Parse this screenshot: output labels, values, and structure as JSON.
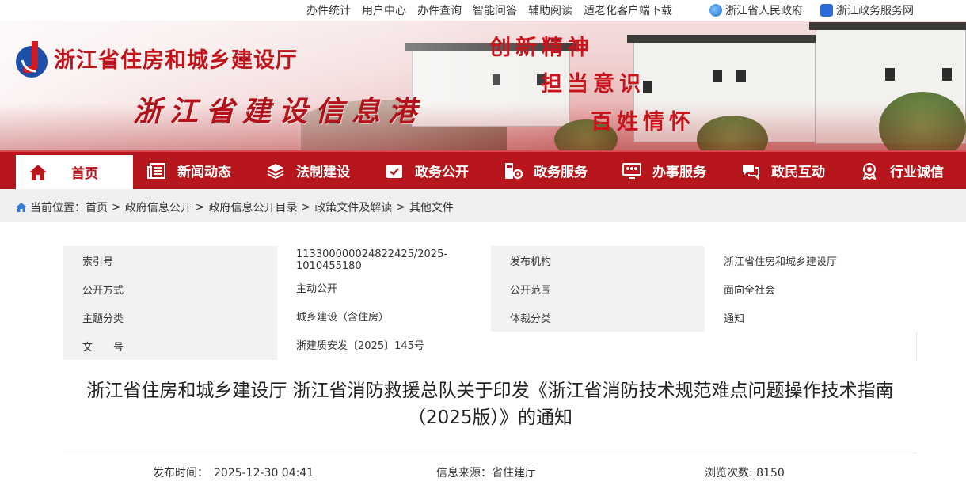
{
  "topbar": {
    "links": [
      "办件统计",
      "用户中心",
      "办件查询",
      "智能问答",
      "辅助阅读",
      "适老化客户端下载"
    ],
    "gov_links": [
      "浙江省人民政府",
      "浙江政务服务网"
    ]
  },
  "banner": {
    "org_name": "浙江省住房和城乡建设厅",
    "site_title": "浙江省建设信息港",
    "slogans": [
      "创新精神",
      "担当意识",
      "百姓情怀"
    ]
  },
  "nav": {
    "items": [
      "首页",
      "新闻动态",
      "法制建设",
      "政务公开",
      "政务服务",
      "办事服务",
      "政民互动",
      "行业诚信"
    ],
    "active": "首页"
  },
  "breadcrumb": {
    "prefix": "当前位置：",
    "items": [
      "首页",
      "政府信息公开",
      "政府信息公开目录",
      "政策文件及解读",
      "其他文件"
    ],
    "separator": ">"
  },
  "meta": {
    "index_label": "索引号",
    "index_value": "113300000024822425/2025-1010455180",
    "publisher_label": "发布机构",
    "publisher_value": "浙江省住房和城乡建设厅",
    "disclosure_label": "公开方式",
    "disclosure_value": "主动公开",
    "scope_label": "公开范围",
    "scope_value": "面向全社会",
    "topic_label": "主题分类",
    "topic_value": "城乡建设（含住房）",
    "genre_label": "体裁分类",
    "genre_value": "通知",
    "docno_label": "文　　号",
    "docno_value": "浙建质安发〔2025〕145号"
  },
  "document": {
    "title": "浙江省住房和城乡建设厅 浙江省消防救援总队关于印发《浙江省消防技术规范难点问题操作技术指南（2025版）》的通知",
    "publish_time": "发布时间：　2025-12-30 04:41",
    "source": "信息来源：省住建厅",
    "views": "浏览次数: 8150"
  },
  "colors": {
    "brand_red": "#b7161d",
    "title_red": "#c0141b"
  }
}
